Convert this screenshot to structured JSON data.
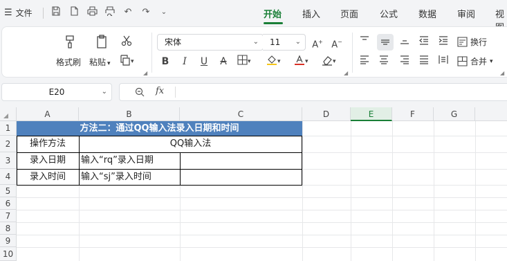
{
  "menubar": {
    "file_label": "文件",
    "tabs": [
      "开始",
      "插入",
      "页面",
      "公式",
      "数据",
      "审阅",
      "视图"
    ],
    "active_tab": "开始"
  },
  "ribbon": {
    "format_painter": "格式刷",
    "paste": "粘贴",
    "font_name": "宋体",
    "font_size": "11",
    "wrap": "换行",
    "merge": "合并"
  },
  "formula_bar": {
    "name_box": "E20",
    "fx": "fx",
    "formula": ""
  },
  "sheet": {
    "columns": [
      "A",
      "B",
      "C",
      "D",
      "E",
      "F",
      "G"
    ],
    "selected_column": "E",
    "rows": [
      "1",
      "2",
      "3",
      "4",
      "5",
      "6",
      "7",
      "8",
      "9",
      "10"
    ],
    "title": "方法二：通过QQ输入法录入日期和时间",
    "header_a": "操作方法",
    "header_bc": "QQ输入法",
    "row3_a": "录入日期",
    "row3_b": "输入“rq”录入日期",
    "row4_a": "录入时间",
    "row4_b": "输入“sj”录入时间"
  },
  "colors": {
    "accent": "#1a7f37",
    "title_band": "#4f81bd"
  }
}
